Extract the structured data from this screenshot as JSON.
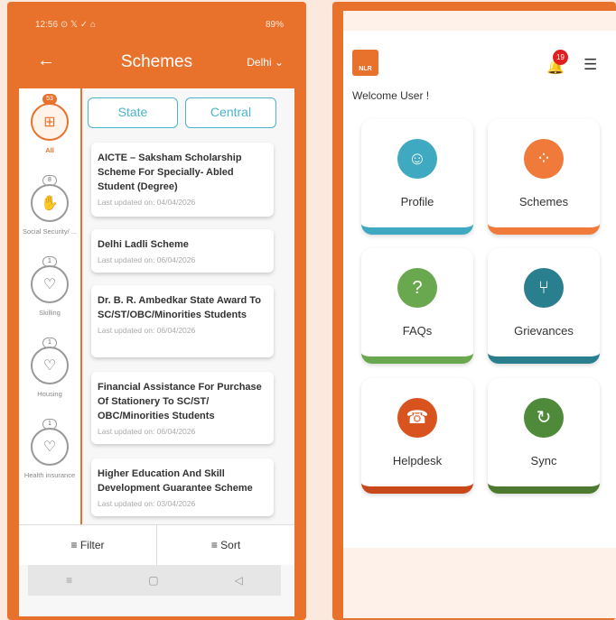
{
  "left_phone": {
    "status": {
      "time": "12:56",
      "status_icons_left": "⊙ 𝕏 ✓ ⌂",
      "battery": "89%"
    },
    "appbar": {
      "back": "←",
      "title": "Schemes",
      "region": "Delhi ⌄"
    },
    "categories": [
      {
        "count": "53",
        "label": "All",
        "icon": "grid-icon",
        "glyph": "⊞"
      },
      {
        "count": "8",
        "label": "Social Security/ ...",
        "icon": "hand-icon",
        "glyph": "✋"
      },
      {
        "count": "1",
        "label": "Skilling",
        "icon": "heart-icon",
        "glyph": "♡"
      },
      {
        "count": "1",
        "label": "Housing",
        "icon": "heart-icon",
        "glyph": "♡"
      },
      {
        "count": "1",
        "label": "Health insurance",
        "icon": "heart-icon",
        "glyph": "♡"
      }
    ],
    "tabs": {
      "state": "State",
      "central": "Central"
    },
    "schemes": [
      {
        "name": "AICTE – Saksham Scholarship Scheme For Specially-    Abled Student (Degree)",
        "updated": "Last updated on: 04/04/2026"
      },
      {
        "name": "Delhi Ladli Scheme",
        "updated": "Last updated on: 06/04/2026"
      },
      {
        "name": "Dr. B. R. Ambedkar State Award To SC/ST/OBC/Minorities Students",
        "updated": "Last updated on: 06/04/2026"
      },
      {
        "name": "Financial Assistance For Purchase Of Stationery To SC/ST/ OBC/Minorities Students",
        "updated": "Last updated on: 06/04/2026"
      },
      {
        "name": "Higher Education And Skill Development Guarantee Scheme",
        "updated": "Last updated on: 03/04/2026"
      }
    ],
    "bottom": {
      "filter": "≡ Filter",
      "sort": "≡ Sort"
    },
    "nav": {
      "recents": "≡",
      "home": "▢",
      "back": "◁"
    }
  },
  "right_phone": {
    "logo_text": "NLR",
    "notification_count": "19",
    "welcome": "Welcome User !",
    "tiles": [
      {
        "label": "Profile",
        "icon": "person-icon",
        "glyph": "☺",
        "color": "#3ea9c0",
        "bar": "#3ea9c0"
      },
      {
        "label": "Schemes",
        "icon": "schemes-icon",
        "glyph": "⁘",
        "color": "#f07a3a",
        "bar": "#f07a3a"
      },
      {
        "label": "FAQs",
        "icon": "faq-icon",
        "glyph": "?",
        "color": "#6aa84f",
        "bar": "#6aa84f"
      },
      {
        "label": "Grievances",
        "icon": "grievance-icon",
        "glyph": "⑂",
        "color": "#2a7f8f",
        "bar": "#2a7f8f"
      },
      {
        "label": "Helpdesk",
        "icon": "headset-icon",
        "glyph": "☎",
        "color": "#d9531e",
        "bar": "#c8481a"
      },
      {
        "label": "Sync",
        "icon": "sync-icon",
        "glyph": "↻",
        "color": "#4e8a3a",
        "bar": "#4e7a30"
      }
    ]
  }
}
